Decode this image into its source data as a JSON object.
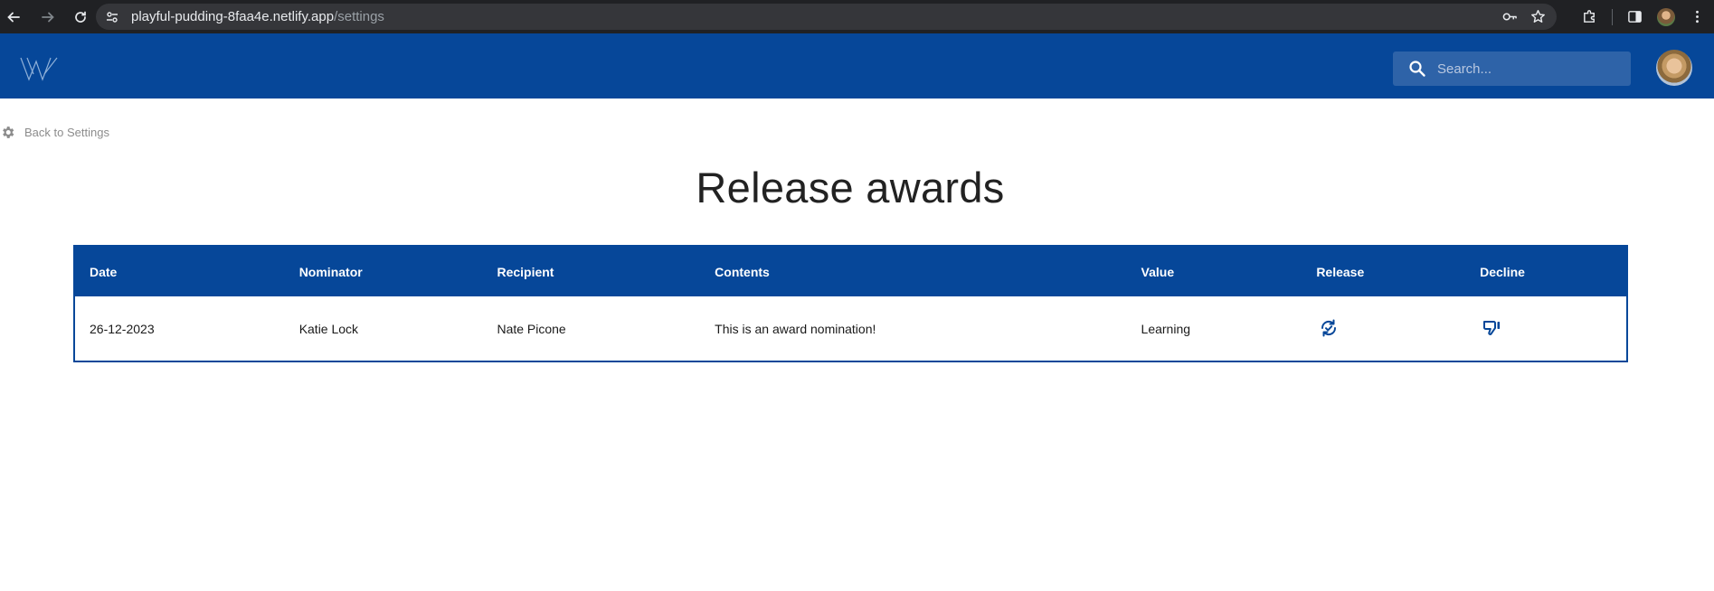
{
  "browser": {
    "url_host": "playful-pudding-8faa4e.netlify.app",
    "url_path": "/settings"
  },
  "header": {
    "search_placeholder": "Search..."
  },
  "back_link": {
    "label": "Back to Settings"
  },
  "page": {
    "title": "Release awards"
  },
  "table": {
    "headers": [
      "Date",
      "Nominator",
      "Recipient",
      "Contents",
      "Value",
      "Release",
      "Decline"
    ],
    "rows": [
      {
        "date": "26-12-2023",
        "nominator": "Katie Lock",
        "recipient": "Nate Picone",
        "contents": "This is an award nomination!",
        "value": "Learning",
        "release_icon": "release-refresh-icon",
        "decline_icon": "thumbs-down-icon"
      }
    ]
  },
  "colors": {
    "brand_blue": "#064799",
    "search_bg": "#2e63a8"
  }
}
